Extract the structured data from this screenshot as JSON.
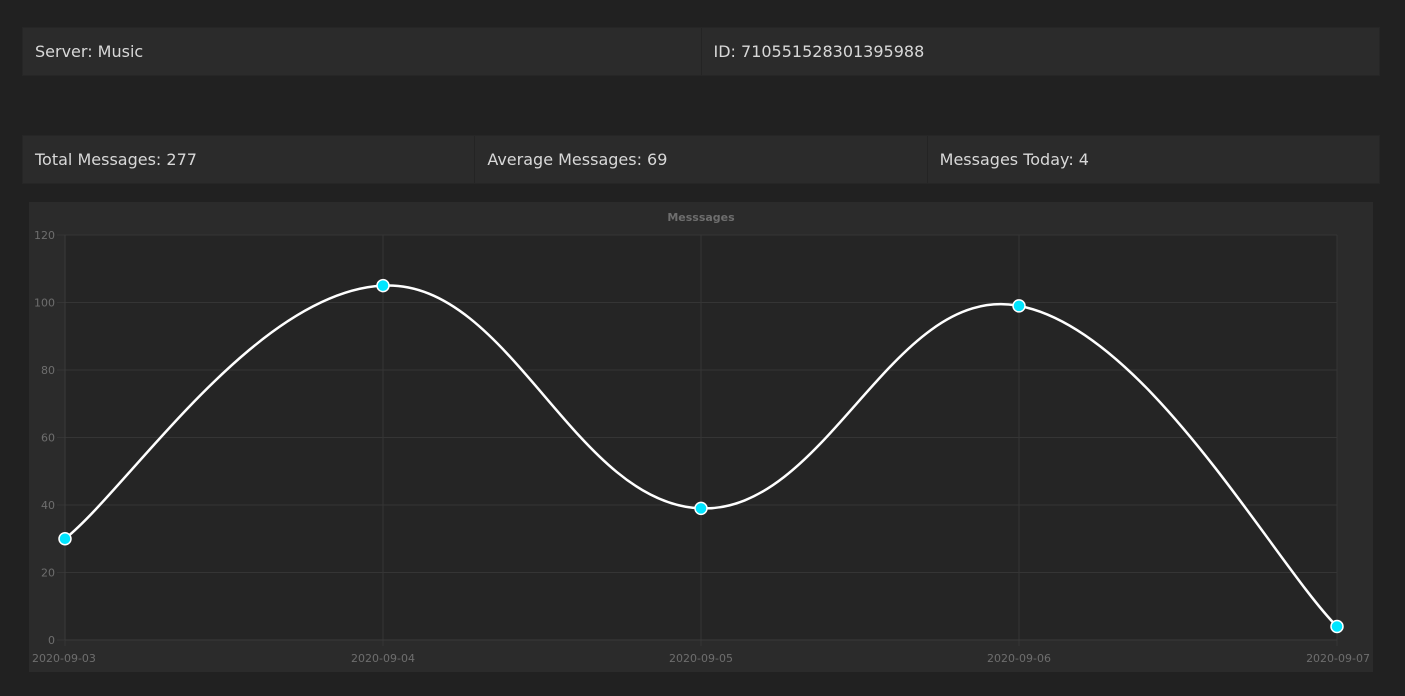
{
  "server": {
    "name_label": "Server: Music",
    "id_label": "ID: 710551528301395988"
  },
  "stats": {
    "total": "Total Messages: 277",
    "average": "Average Messages: 69",
    "today": "Messages Today: 4"
  },
  "colors": {
    "line": "#ffffff",
    "point": "#00e5ff",
    "point_border": "#ffffff",
    "grid": "#353535"
  },
  "chart_data": {
    "type": "line",
    "title": "Messsages",
    "x": [
      "2020-09-03",
      "2020-09-04",
      "2020-09-05",
      "2020-09-06",
      "2020-09-07"
    ],
    "series": [
      {
        "values": [
          30,
          105,
          39,
          99,
          4
        ]
      }
    ],
    "ylim": [
      0,
      120
    ],
    "yticks": [
      0,
      20,
      40,
      60,
      80,
      100,
      120
    ],
    "grid": true,
    "legend": "none"
  }
}
